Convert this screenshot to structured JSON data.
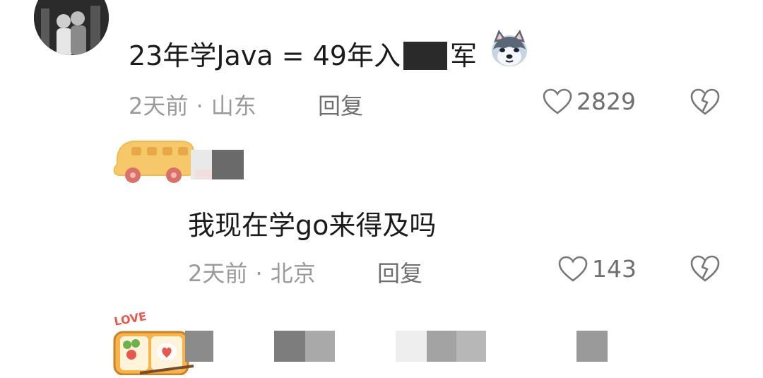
{
  "comments": [
    {
      "text_before": "23年学Java = 49年入",
      "text_after": "军",
      "emoji": "husky-dog-emoji",
      "time": "2天前",
      "separator": "·",
      "location": "山东",
      "reply_label": "回复",
      "like_count": "2829"
    },
    {
      "text": "我现在学go来得及吗",
      "time": "2天前",
      "separator": "·",
      "location": "北京",
      "reply_label": "回复",
      "like_count": "143"
    }
  ],
  "sticker_label": "LOVE",
  "colors": {
    "text": "#1b1b1b",
    "meta": "#9a9a9a",
    "icon": "#777777",
    "bus": "#f7c86a",
    "wheel": "#d9706a"
  }
}
